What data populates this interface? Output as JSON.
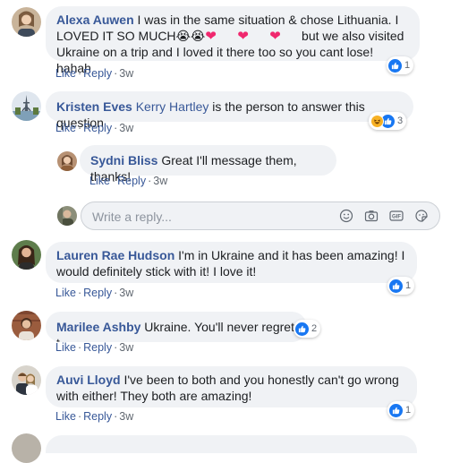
{
  "comments": [
    {
      "author": "Alexa Auwen",
      "text_line1": "I was in the same situation & chose Lithuania. I",
      "text_line2": "LOVED IT SO MUCH",
      "text_line2b": "but we also visited",
      "text_line3": "Ukraine on a trip and I loved it there too so you cant lose! hahah",
      "like": "Like",
      "reply": "Reply",
      "time": "3w",
      "reaction_count": "1"
    },
    {
      "author": "Kristen Eves",
      "mention": "Kerry Hartley",
      "text": "is the person to answer this question",
      "like": "Like",
      "reply": "Reply",
      "time": "3w",
      "reaction_count": "3"
    },
    {
      "author": "Sydni Bliss",
      "text": "Great I'll message them, thanks!",
      "like": "Like",
      "reply": "Reply",
      "time": "3w"
    },
    {
      "author": "Lauren Rae Hudson",
      "text_line1": "I'm in Ukraine and it has been amazing! I",
      "text_line2": "would definitely stick with it! I love it!",
      "like": "Like",
      "reply": "Reply",
      "time": "3w",
      "reaction_count": "1"
    },
    {
      "author": "Marilee Ashby",
      "text": "Ukraine. You'll never regret t",
      "like": "Like",
      "reply": "Reply",
      "time": "3w",
      "reaction_count": "2"
    },
    {
      "author": "Auvi Lloyd",
      "text_line1": "I've been to both and you honestly can't go wrong",
      "text_line2": "with either! They both are amazing!",
      "like": "Like",
      "reply": "Reply",
      "time": "3w",
      "reaction_count": "1"
    }
  ],
  "reply_box": {
    "placeholder": "Write a reply..."
  },
  "colors": {
    "link": "#385898",
    "bubble": "#f0f2f5",
    "like_blue": "#1877f2",
    "heart": "#f0286e"
  },
  "icons": [
    "like-icon",
    "haha-icon",
    "heart-icon",
    "crying-face-icon",
    "emoji-icon",
    "camera-icon",
    "gif-icon",
    "sticker-icon"
  ]
}
